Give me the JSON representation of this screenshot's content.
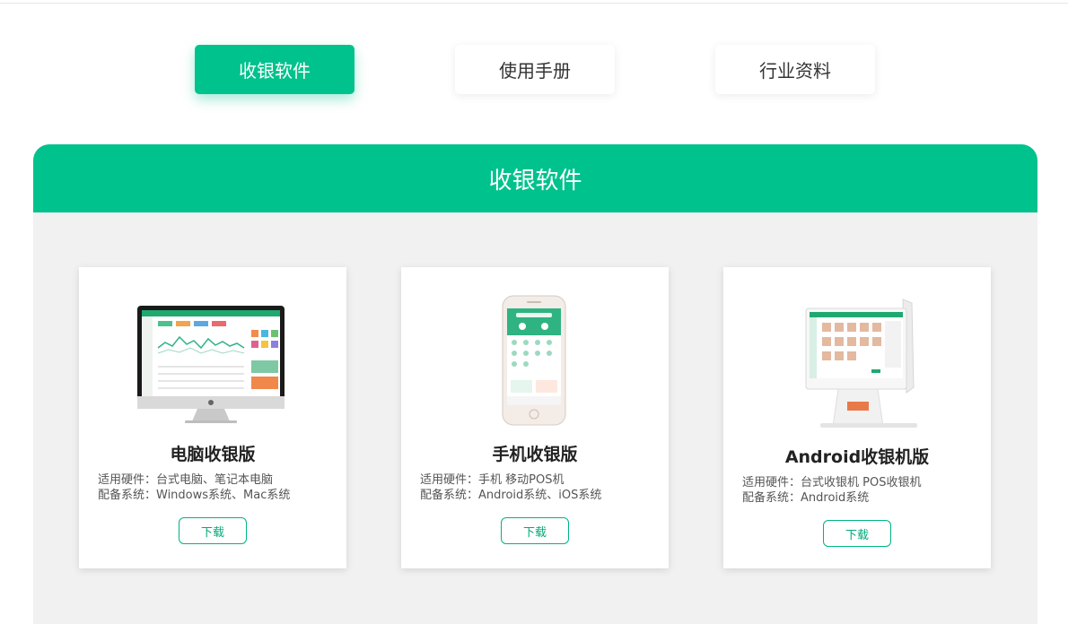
{
  "tabs": [
    {
      "label": "收银软件",
      "active": true
    },
    {
      "label": "使用手册",
      "active": false
    },
    {
      "label": "行业资料",
      "active": false
    }
  ],
  "panel": {
    "title": "收银软件"
  },
  "cards": [
    {
      "title": "电脑收银版",
      "hardware": "适用硬件：台式电脑、笔记本电脑",
      "system": "配备系统：Windows系统、Mac系统",
      "button": "下载",
      "image": "desktop-computer-image"
    },
    {
      "title": "手机收银版",
      "hardware": "适用硬件：手机 移动POS机",
      "system": "配备系统：Android系统、iOS系统",
      "button": "下载",
      "image": "smartphone-image"
    },
    {
      "title": "Android收银机版",
      "hardware": "适用硬件：台式收银机 POS收银机",
      "system": "配备系统：Android系统",
      "button": "下载",
      "image": "pos-terminal-image"
    }
  ],
  "colors": {
    "accent": "#00c28d",
    "panel_bg": "#f1f1f1"
  }
}
